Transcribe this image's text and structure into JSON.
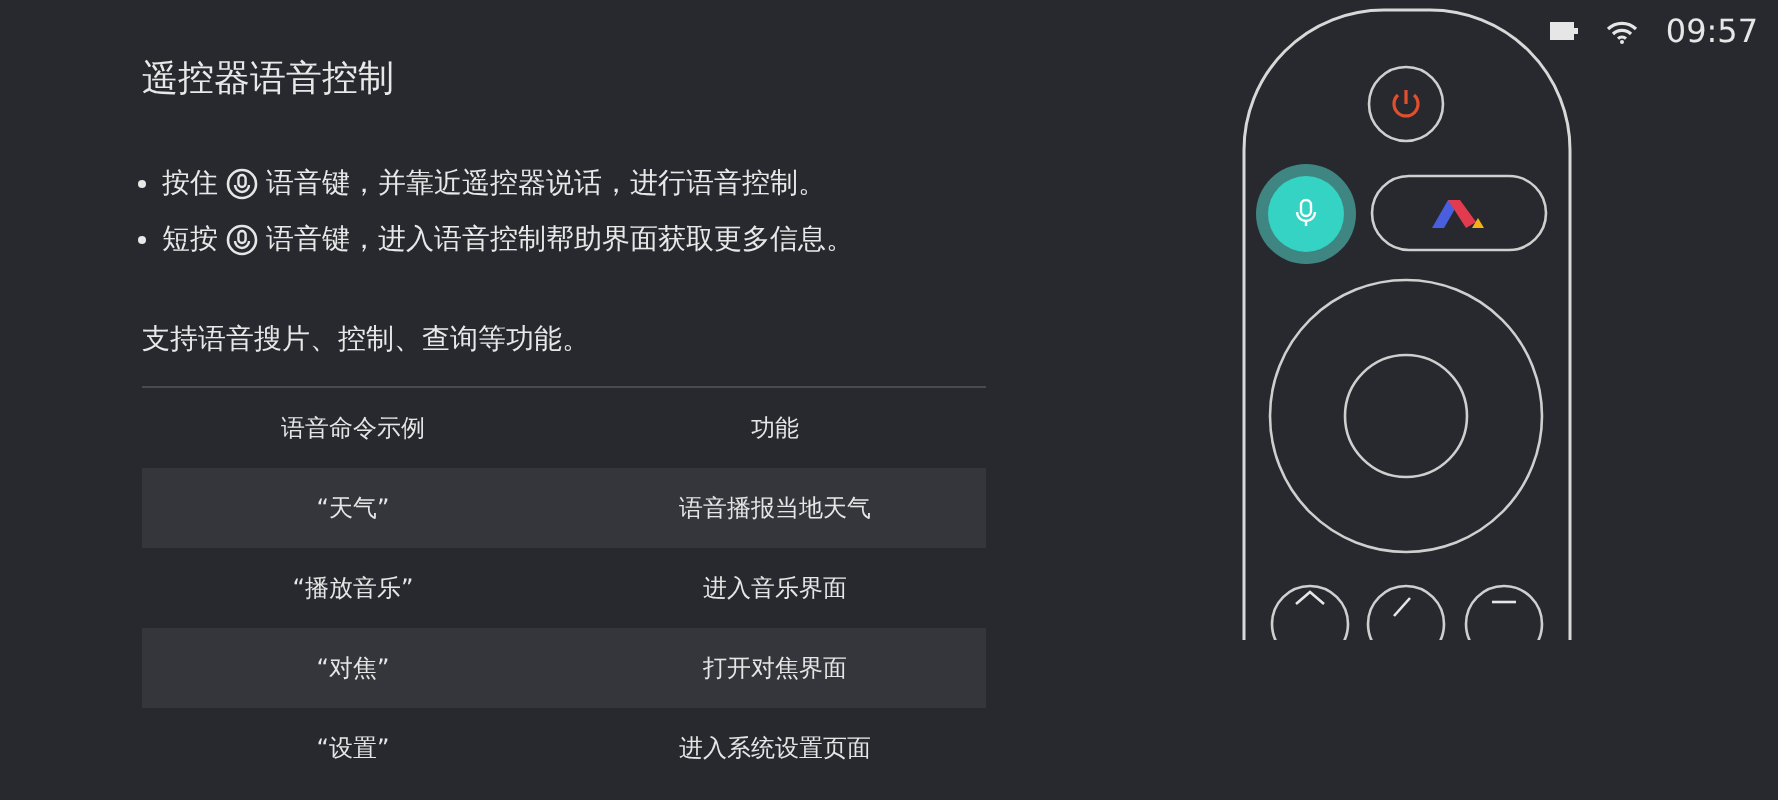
{
  "status_bar": {
    "time": "09:57"
  },
  "title": "遥控器语音控制",
  "bullets": [
    {
      "before": "按住",
      "after": "语音键，并靠近遥控器说话，进行语音控制。"
    },
    {
      "before": "短按",
      "after": "语音键，进入语音控制帮助界面获取更多信息。"
    }
  ],
  "intro": "支持语音搜片、控制、查询等功能。",
  "table": {
    "columns": [
      "语音命令示例",
      "功能"
    ],
    "rows": [
      [
        "“天气”",
        "语音播报当地天气"
      ],
      [
        "“播放音乐”",
        "进入音乐界面"
      ],
      [
        "“对焦”",
        "打开对焦界面"
      ],
      [
        "“设置”",
        "进入系统设置页面"
      ]
    ]
  },
  "remote": {
    "voice_key_highlighted": true
  }
}
